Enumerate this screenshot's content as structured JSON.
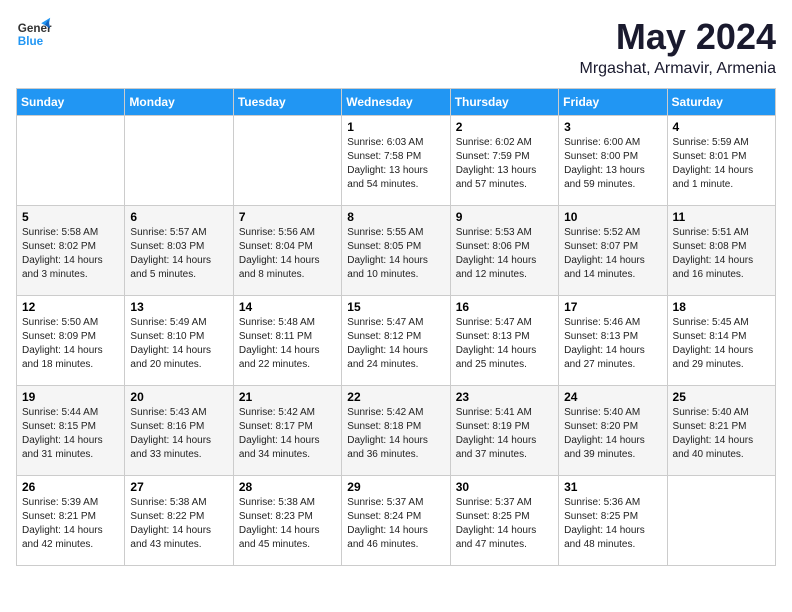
{
  "header": {
    "logo_general": "General",
    "logo_blue": "Blue",
    "title": "May 2024",
    "subtitle": "Mrgashat, Armavir, Armenia"
  },
  "calendar": {
    "days_of_week": [
      "Sunday",
      "Monday",
      "Tuesday",
      "Wednesday",
      "Thursday",
      "Friday",
      "Saturday"
    ],
    "weeks": [
      [
        {
          "day": "",
          "info": ""
        },
        {
          "day": "",
          "info": ""
        },
        {
          "day": "",
          "info": ""
        },
        {
          "day": "1",
          "info": "Sunrise: 6:03 AM\nSunset: 7:58 PM\nDaylight: 13 hours\nand 54 minutes."
        },
        {
          "day": "2",
          "info": "Sunrise: 6:02 AM\nSunset: 7:59 PM\nDaylight: 13 hours\nand 57 minutes."
        },
        {
          "day": "3",
          "info": "Sunrise: 6:00 AM\nSunset: 8:00 PM\nDaylight: 13 hours\nand 59 minutes."
        },
        {
          "day": "4",
          "info": "Sunrise: 5:59 AM\nSunset: 8:01 PM\nDaylight: 14 hours\nand 1 minute."
        }
      ],
      [
        {
          "day": "5",
          "info": "Sunrise: 5:58 AM\nSunset: 8:02 PM\nDaylight: 14 hours\nand 3 minutes."
        },
        {
          "day": "6",
          "info": "Sunrise: 5:57 AM\nSunset: 8:03 PM\nDaylight: 14 hours\nand 5 minutes."
        },
        {
          "day": "7",
          "info": "Sunrise: 5:56 AM\nSunset: 8:04 PM\nDaylight: 14 hours\nand 8 minutes."
        },
        {
          "day": "8",
          "info": "Sunrise: 5:55 AM\nSunset: 8:05 PM\nDaylight: 14 hours\nand 10 minutes."
        },
        {
          "day": "9",
          "info": "Sunrise: 5:53 AM\nSunset: 8:06 PM\nDaylight: 14 hours\nand 12 minutes."
        },
        {
          "day": "10",
          "info": "Sunrise: 5:52 AM\nSunset: 8:07 PM\nDaylight: 14 hours\nand 14 minutes."
        },
        {
          "day": "11",
          "info": "Sunrise: 5:51 AM\nSunset: 8:08 PM\nDaylight: 14 hours\nand 16 minutes."
        }
      ],
      [
        {
          "day": "12",
          "info": "Sunrise: 5:50 AM\nSunset: 8:09 PM\nDaylight: 14 hours\nand 18 minutes."
        },
        {
          "day": "13",
          "info": "Sunrise: 5:49 AM\nSunset: 8:10 PM\nDaylight: 14 hours\nand 20 minutes."
        },
        {
          "day": "14",
          "info": "Sunrise: 5:48 AM\nSunset: 8:11 PM\nDaylight: 14 hours\nand 22 minutes."
        },
        {
          "day": "15",
          "info": "Sunrise: 5:47 AM\nSunset: 8:12 PM\nDaylight: 14 hours\nand 24 minutes."
        },
        {
          "day": "16",
          "info": "Sunrise: 5:47 AM\nSunset: 8:13 PM\nDaylight: 14 hours\nand 25 minutes."
        },
        {
          "day": "17",
          "info": "Sunrise: 5:46 AM\nSunset: 8:13 PM\nDaylight: 14 hours\nand 27 minutes."
        },
        {
          "day": "18",
          "info": "Sunrise: 5:45 AM\nSunset: 8:14 PM\nDaylight: 14 hours\nand 29 minutes."
        }
      ],
      [
        {
          "day": "19",
          "info": "Sunrise: 5:44 AM\nSunset: 8:15 PM\nDaylight: 14 hours\nand 31 minutes."
        },
        {
          "day": "20",
          "info": "Sunrise: 5:43 AM\nSunset: 8:16 PM\nDaylight: 14 hours\nand 33 minutes."
        },
        {
          "day": "21",
          "info": "Sunrise: 5:42 AM\nSunset: 8:17 PM\nDaylight: 14 hours\nand 34 minutes."
        },
        {
          "day": "22",
          "info": "Sunrise: 5:42 AM\nSunset: 8:18 PM\nDaylight: 14 hours\nand 36 minutes."
        },
        {
          "day": "23",
          "info": "Sunrise: 5:41 AM\nSunset: 8:19 PM\nDaylight: 14 hours\nand 37 minutes."
        },
        {
          "day": "24",
          "info": "Sunrise: 5:40 AM\nSunset: 8:20 PM\nDaylight: 14 hours\nand 39 minutes."
        },
        {
          "day": "25",
          "info": "Sunrise: 5:40 AM\nSunset: 8:21 PM\nDaylight: 14 hours\nand 40 minutes."
        }
      ],
      [
        {
          "day": "26",
          "info": "Sunrise: 5:39 AM\nSunset: 8:21 PM\nDaylight: 14 hours\nand 42 minutes."
        },
        {
          "day": "27",
          "info": "Sunrise: 5:38 AM\nSunset: 8:22 PM\nDaylight: 14 hours\nand 43 minutes."
        },
        {
          "day": "28",
          "info": "Sunrise: 5:38 AM\nSunset: 8:23 PM\nDaylight: 14 hours\nand 45 minutes."
        },
        {
          "day": "29",
          "info": "Sunrise: 5:37 AM\nSunset: 8:24 PM\nDaylight: 14 hours\nand 46 minutes."
        },
        {
          "day": "30",
          "info": "Sunrise: 5:37 AM\nSunset: 8:25 PM\nDaylight: 14 hours\nand 47 minutes."
        },
        {
          "day": "31",
          "info": "Sunrise: 5:36 AM\nSunset: 8:25 PM\nDaylight: 14 hours\nand 48 minutes."
        },
        {
          "day": "",
          "info": ""
        }
      ]
    ]
  }
}
